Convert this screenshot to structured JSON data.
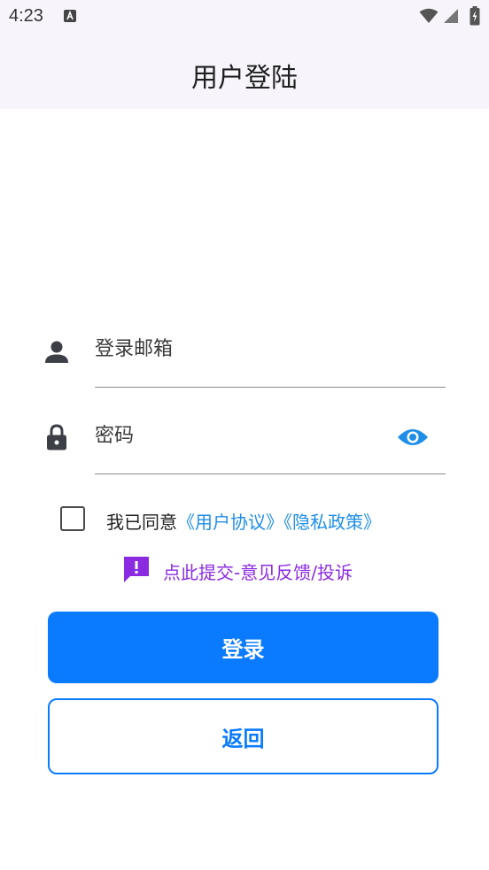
{
  "status_bar": {
    "time": "4:23",
    "icons": [
      "a-notification-icon",
      "wifi-icon",
      "signal-icon",
      "battery-icon"
    ]
  },
  "app_bar": {
    "title": "用户登陆"
  },
  "form": {
    "email": {
      "placeholder": "登录邮箱",
      "value": "",
      "icon": "person-icon"
    },
    "password": {
      "placeholder": "密码",
      "value": "",
      "icon": "lock-icon",
      "toggle_icon": "eye-icon"
    }
  },
  "agreement": {
    "checked": false,
    "prefix": "我已同意",
    "user_agreement": "《用户协议》",
    "privacy_policy": "《隐私政策》"
  },
  "feedback": {
    "icon": "feedback-icon",
    "label": "点此提交-意见反馈/投诉"
  },
  "buttons": {
    "login": "登录",
    "back": "返回"
  },
  "colors": {
    "primary": "#0a7bff",
    "link": "#1f8ee8",
    "feedback": "#8a2be2",
    "bar_background": "#f7f5fb"
  }
}
